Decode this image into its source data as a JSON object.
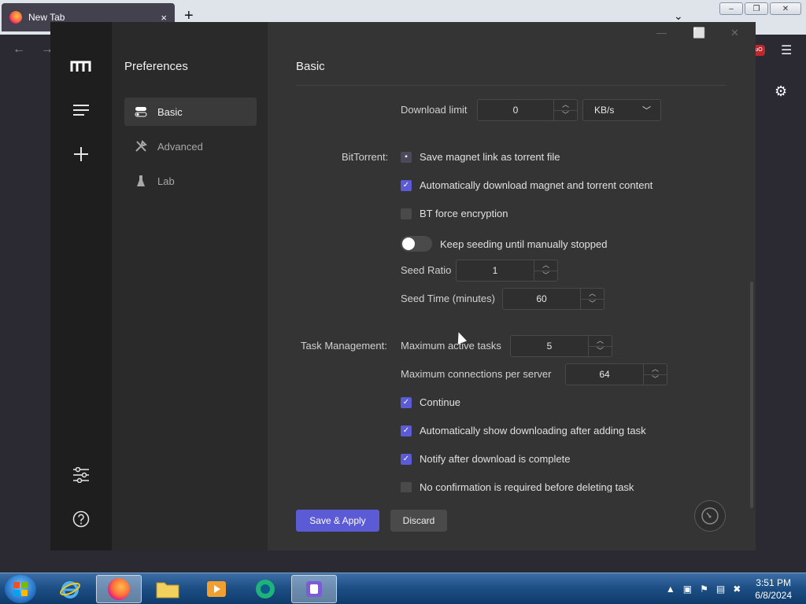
{
  "browser": {
    "tab_title": "New Tab",
    "tab_close": "×",
    "new_tab": "+",
    "dropdown": "⌄",
    "nav_back": "←",
    "nav_forward": "→",
    "menu_icon": "☰",
    "ext_badge": "uO",
    "settings_icon": "⚙",
    "win_min": "–",
    "win_restore": "❐",
    "win_close": "✕"
  },
  "app": {
    "sidebar_title": "Preferences",
    "menu": [
      {
        "label": "Basic",
        "active": true
      },
      {
        "label": "Advanced",
        "active": false
      },
      {
        "label": "Lab",
        "active": false
      }
    ],
    "page_title": "Basic",
    "window_min": "—",
    "window_max": "⬜",
    "window_close": "✕"
  },
  "form": {
    "download_limit_label": "Download limit",
    "download_limit_value": "0",
    "download_limit_unit": "KB/s",
    "bittorrent_label": "BitTorrent:",
    "bt_options": [
      {
        "label": "Save magnet link as torrent file",
        "state": "partial"
      },
      {
        "label": "Automatically download magnet and torrent content",
        "state": "on"
      },
      {
        "label": "BT force encryption",
        "state": "off"
      }
    ],
    "keep_seeding_label": "Keep seeding until manually stopped",
    "keep_seeding_on": false,
    "seed_ratio_label": "Seed Ratio",
    "seed_ratio_value": "1",
    "seed_time_label": "Seed Time (minutes)",
    "seed_time_value": "60",
    "task_mgmt_label": "Task Management:",
    "max_active_label": "Maximum active tasks",
    "max_active_value": "5",
    "max_conn_label": "Maximum connections per server",
    "max_conn_value": "64",
    "task_options": [
      {
        "label": "Continue",
        "state": "on"
      },
      {
        "label": "Automatically show downloading after adding task",
        "state": "on"
      },
      {
        "label": "Notify after download is complete",
        "state": "on"
      },
      {
        "label": "No confirmation is required before deleting task",
        "state": "off"
      }
    ]
  },
  "actions": {
    "save_label": "Save & Apply",
    "discard_label": "Discard"
  },
  "taskbar": {
    "time": "3:51 PM",
    "date": "6/8/2024"
  },
  "colors": {
    "accent": "#5b5bd6",
    "panel": "#343434",
    "sidebar": "#2a2a2a",
    "rail": "#1e1e1e"
  }
}
